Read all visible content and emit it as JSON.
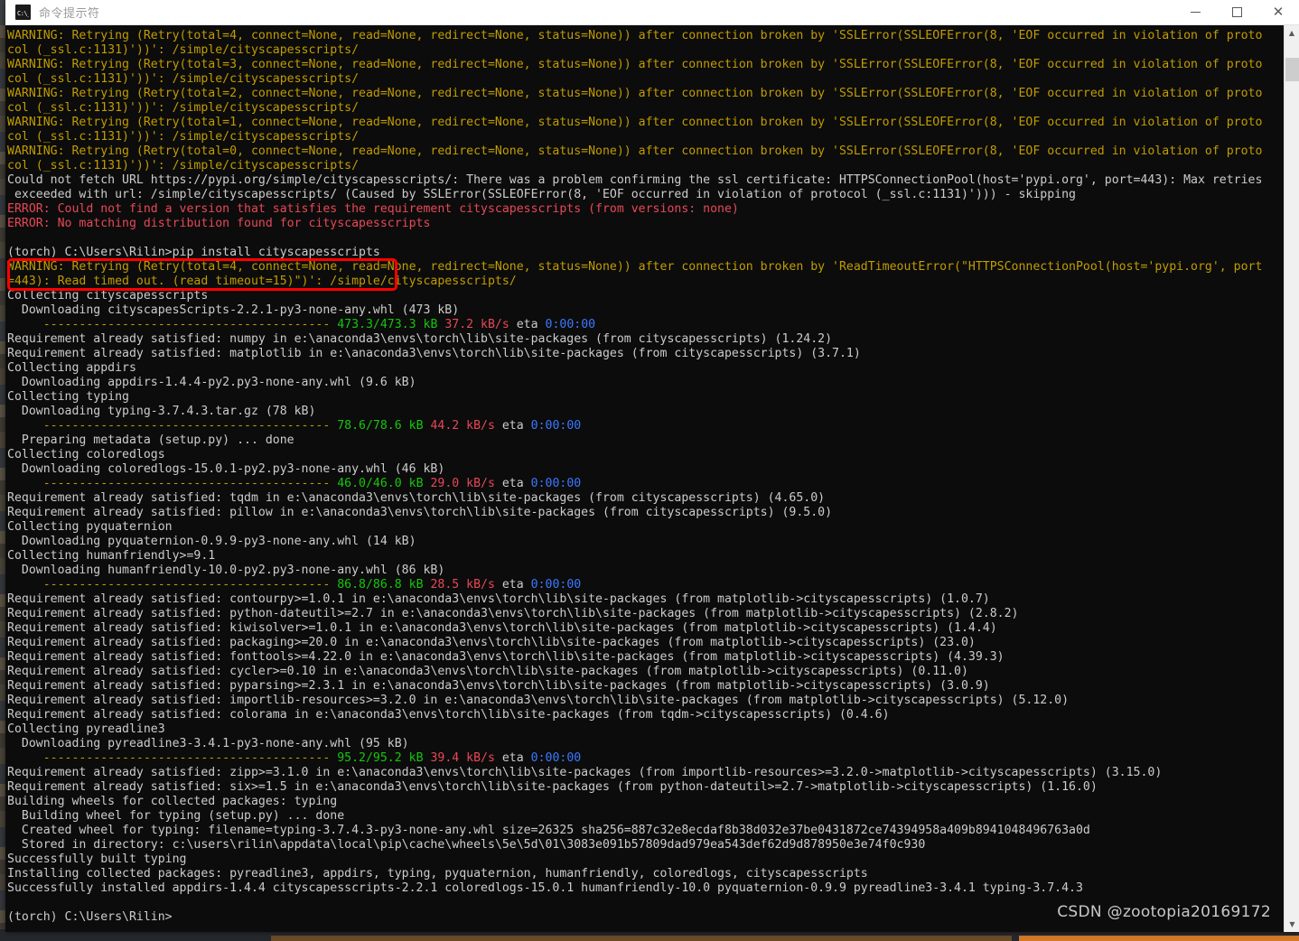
{
  "window": {
    "title": "命令提示符",
    "icon": "cmd-prompt-icon",
    "controls": {
      "minimize": "—",
      "maximize": "□",
      "close": "✕"
    }
  },
  "scrollbar": {
    "up_arrow": "▲",
    "down_arrow": "▼"
  },
  "watermark": "CSDN @zootopia20169172",
  "annotation": {
    "type": "red-rectangle-highlight",
    "color": "#ff0000",
    "target_text": "(torch) C:\\Users\\Rilin>pip install cityscapesscripts"
  },
  "palette": {
    "background": "#0c0c0c",
    "default_text": "#cccccc",
    "warning_yellow": "#c19c00",
    "error_red": "#e74856",
    "size_green": "#16c60c",
    "speed_red": "#e74856",
    "eta_blue": "#3b78ff",
    "progress_bar_yellow": "#c19c00"
  },
  "console": {
    "lines": [
      [
        {
          "t": "WARNING: Retrying (Retry(total=4, connect=None, read=None, redirect=None, status=None)) after connection broken by 'SSLError(SSLEOFError(8, 'EOF occurred in violation of proto",
          "c": "c-yellow"
        }
      ],
      [
        {
          "t": "col (_ssl.c:1131)'))': /simple/cityscapesscripts/",
          "c": "c-yellow"
        }
      ],
      [
        {
          "t": "WARNING: Retrying (Retry(total=3, connect=None, read=None, redirect=None, status=None)) after connection broken by 'SSLError(SSLEOFError(8, 'EOF occurred in violation of proto",
          "c": "c-yellow"
        }
      ],
      [
        {
          "t": "col (_ssl.c:1131)'))': /simple/cityscapesscripts/",
          "c": "c-yellow"
        }
      ],
      [
        {
          "t": "WARNING: Retrying (Retry(total=2, connect=None, read=None, redirect=None, status=None)) after connection broken by 'SSLError(SSLEOFError(8, 'EOF occurred in violation of proto",
          "c": "c-yellow"
        }
      ],
      [
        {
          "t": "col (_ssl.c:1131)'))': /simple/cityscapesscripts/",
          "c": "c-yellow"
        }
      ],
      [
        {
          "t": "WARNING: Retrying (Retry(total=1, connect=None, read=None, redirect=None, status=None)) after connection broken by 'SSLError(SSLEOFError(8, 'EOF occurred in violation of proto",
          "c": "c-yellow"
        }
      ],
      [
        {
          "t": "col (_ssl.c:1131)'))': /simple/cityscapesscripts/",
          "c": "c-yellow"
        }
      ],
      [
        {
          "t": "WARNING: Retrying (Retry(total=0, connect=None, read=None, redirect=None, status=None)) after connection broken by 'SSLError(SSLEOFError(8, 'EOF occurred in violation of proto",
          "c": "c-yellow"
        }
      ],
      [
        {
          "t": "col (_ssl.c:1131)'))': /simple/cityscapesscripts/",
          "c": "c-yellow"
        }
      ],
      [
        {
          "t": "Could not fetch URL https://pypi.org/simple/cityscapesscripts/: There was a problem confirming the ssl certificate: HTTPSConnectionPool(host='pypi.org', port=443): Max retries",
          "c": "c-white"
        }
      ],
      [
        {
          "t": " exceeded with url: /simple/cityscapesscripts/ (Caused by SSLError(SSLEOFError(8, 'EOF occurred in violation of protocol (_ssl.c:1131)'))) - skipping",
          "c": "c-white"
        }
      ],
      [
        {
          "t": "ERROR: Could not find a version that satisfies the requirement cityscapesscripts (from versions: none)",
          "c": "c-red"
        }
      ],
      [
        {
          "t": "ERROR: No matching distribution found for cityscapesscripts",
          "c": "c-red"
        }
      ],
      [
        {
          "t": "",
          "c": "c-white"
        }
      ],
      [
        {
          "t": "(torch) C:\\Users\\Rilin>pip install cityscapesscripts",
          "c": "c-white"
        }
      ],
      [
        {
          "t": "WARNING: Retrying (Retry(total=4, connect=None, read=None, redirect=None, status=None)) after connection broken by 'ReadTimeoutError(\"HTTPSConnectionPool(host='pypi.org', port",
          "c": "c-yellow"
        }
      ],
      [
        {
          "t": "=443): Read timed out. (read timeout=15)\")': /simple/cityscapesscripts/",
          "c": "c-yellow"
        }
      ],
      [
        {
          "t": "Collecting cityscapesscripts",
          "c": "c-white"
        }
      ],
      [
        {
          "t": "  Downloading cityscapesScripts-2.2.1-py3-none-any.whl (473 kB)",
          "c": "c-white"
        }
      ],
      [
        {
          "t": "     ",
          "c": "c-white"
        },
        {
          "t": "---------------------------------------- ",
          "c": "c-yellow"
        },
        {
          "t": "473.3/473.3 kB ",
          "c": "c-green"
        },
        {
          "t": "37.2 kB/s ",
          "c": "c-red"
        },
        {
          "t": "eta ",
          "c": "c-white"
        },
        {
          "t": "0:00:00",
          "c": "c-cyan"
        }
      ],
      [
        {
          "t": "Requirement already satisfied: numpy in e:\\anaconda3\\envs\\torch\\lib\\site-packages (from cityscapesscripts) (1.24.2)",
          "c": "c-white"
        }
      ],
      [
        {
          "t": "Requirement already satisfied: matplotlib in e:\\anaconda3\\envs\\torch\\lib\\site-packages (from cityscapesscripts) (3.7.1)",
          "c": "c-white"
        }
      ],
      [
        {
          "t": "Collecting appdirs",
          "c": "c-white"
        }
      ],
      [
        {
          "t": "  Downloading appdirs-1.4.4-py2.py3-none-any.whl (9.6 kB)",
          "c": "c-white"
        }
      ],
      [
        {
          "t": "Collecting typing",
          "c": "c-white"
        }
      ],
      [
        {
          "t": "  Downloading typing-3.7.4.3.tar.gz (78 kB)",
          "c": "c-white"
        }
      ],
      [
        {
          "t": "     ",
          "c": "c-white"
        },
        {
          "t": "---------------------------------------- ",
          "c": "c-yellow"
        },
        {
          "t": "78.6/78.6 kB ",
          "c": "c-green"
        },
        {
          "t": "44.2 kB/s ",
          "c": "c-red"
        },
        {
          "t": "eta ",
          "c": "c-white"
        },
        {
          "t": "0:00:00",
          "c": "c-cyan"
        }
      ],
      [
        {
          "t": "  Preparing metadata (setup.py) ... done",
          "c": "c-white"
        }
      ],
      [
        {
          "t": "Collecting coloredlogs",
          "c": "c-white"
        }
      ],
      [
        {
          "t": "  Downloading coloredlogs-15.0.1-py2.py3-none-any.whl (46 kB)",
          "c": "c-white"
        }
      ],
      [
        {
          "t": "     ",
          "c": "c-white"
        },
        {
          "t": "---------------------------------------- ",
          "c": "c-yellow"
        },
        {
          "t": "46.0/46.0 kB ",
          "c": "c-green"
        },
        {
          "t": "29.0 kB/s ",
          "c": "c-red"
        },
        {
          "t": "eta ",
          "c": "c-white"
        },
        {
          "t": "0:00:00",
          "c": "c-cyan"
        }
      ],
      [
        {
          "t": "Requirement already satisfied: tqdm in e:\\anaconda3\\envs\\torch\\lib\\site-packages (from cityscapesscripts) (4.65.0)",
          "c": "c-white"
        }
      ],
      [
        {
          "t": "Requirement already satisfied: pillow in e:\\anaconda3\\envs\\torch\\lib\\site-packages (from cityscapesscripts) (9.5.0)",
          "c": "c-white"
        }
      ],
      [
        {
          "t": "Collecting pyquaternion",
          "c": "c-white"
        }
      ],
      [
        {
          "t": "  Downloading pyquaternion-0.9.9-py3-none-any.whl (14 kB)",
          "c": "c-white"
        }
      ],
      [
        {
          "t": "Collecting humanfriendly>=9.1",
          "c": "c-white"
        }
      ],
      [
        {
          "t": "  Downloading humanfriendly-10.0-py2.py3-none-any.whl (86 kB)",
          "c": "c-white"
        }
      ],
      [
        {
          "t": "     ",
          "c": "c-white"
        },
        {
          "t": "---------------------------------------- ",
          "c": "c-yellow"
        },
        {
          "t": "86.8/86.8 kB ",
          "c": "c-green"
        },
        {
          "t": "28.5 kB/s ",
          "c": "c-red"
        },
        {
          "t": "eta ",
          "c": "c-white"
        },
        {
          "t": "0:00:00",
          "c": "c-cyan"
        }
      ],
      [
        {
          "t": "Requirement already satisfied: contourpy>=1.0.1 in e:\\anaconda3\\envs\\torch\\lib\\site-packages (from matplotlib->cityscapesscripts) (1.0.7)",
          "c": "c-white"
        }
      ],
      [
        {
          "t": "Requirement already satisfied: python-dateutil>=2.7 in e:\\anaconda3\\envs\\torch\\lib\\site-packages (from matplotlib->cityscapesscripts) (2.8.2)",
          "c": "c-white"
        }
      ],
      [
        {
          "t": "Requirement already satisfied: kiwisolver>=1.0.1 in e:\\anaconda3\\envs\\torch\\lib\\site-packages (from matplotlib->cityscapesscripts) (1.4.4)",
          "c": "c-white"
        }
      ],
      [
        {
          "t": "Requirement already satisfied: packaging>=20.0 in e:\\anaconda3\\envs\\torch\\lib\\site-packages (from matplotlib->cityscapesscripts) (23.0)",
          "c": "c-white"
        }
      ],
      [
        {
          "t": "Requirement already satisfied: fonttools>=4.22.0 in e:\\anaconda3\\envs\\torch\\lib\\site-packages (from matplotlib->cityscapesscripts) (4.39.3)",
          "c": "c-white"
        }
      ],
      [
        {
          "t": "Requirement already satisfied: cycler>=0.10 in e:\\anaconda3\\envs\\torch\\lib\\site-packages (from matplotlib->cityscapesscripts) (0.11.0)",
          "c": "c-white"
        }
      ],
      [
        {
          "t": "Requirement already satisfied: pyparsing>=2.3.1 in e:\\anaconda3\\envs\\torch\\lib\\site-packages (from matplotlib->cityscapesscripts) (3.0.9)",
          "c": "c-white"
        }
      ],
      [
        {
          "t": "Requirement already satisfied: importlib-resources>=3.2.0 in e:\\anaconda3\\envs\\torch\\lib\\site-packages (from matplotlib->cityscapesscripts) (5.12.0)",
          "c": "c-white"
        }
      ],
      [
        {
          "t": "Requirement already satisfied: colorama in e:\\anaconda3\\envs\\torch\\lib\\site-packages (from tqdm->cityscapesscripts) (0.4.6)",
          "c": "c-white"
        }
      ],
      [
        {
          "t": "Collecting pyreadline3",
          "c": "c-white"
        }
      ],
      [
        {
          "t": "  Downloading pyreadline3-3.4.1-py3-none-any.whl (95 kB)",
          "c": "c-white"
        }
      ],
      [
        {
          "t": "     ",
          "c": "c-white"
        },
        {
          "t": "---------------------------------------- ",
          "c": "c-yellow"
        },
        {
          "t": "95.2/95.2 kB ",
          "c": "c-green"
        },
        {
          "t": "39.4 kB/s ",
          "c": "c-red"
        },
        {
          "t": "eta ",
          "c": "c-white"
        },
        {
          "t": "0:00:00",
          "c": "c-cyan"
        }
      ],
      [
        {
          "t": "Requirement already satisfied: zipp>=3.1.0 in e:\\anaconda3\\envs\\torch\\lib\\site-packages (from importlib-resources>=3.2.0->matplotlib->cityscapesscripts) (3.15.0)",
          "c": "c-white"
        }
      ],
      [
        {
          "t": "Requirement already satisfied: six>=1.5 in e:\\anaconda3\\envs\\torch\\lib\\site-packages (from python-dateutil>=2.7->matplotlib->cityscapesscripts) (1.16.0)",
          "c": "c-white"
        }
      ],
      [
        {
          "t": "Building wheels for collected packages: typing",
          "c": "c-white"
        }
      ],
      [
        {
          "t": "  Building wheel for typing (setup.py) ... done",
          "c": "c-white"
        }
      ],
      [
        {
          "t": "  Created wheel for typing: filename=typing-3.7.4.3-py3-none-any.whl size=26325 sha256=887c32e8ecdaf8b38d032e37be0431872ce74394958a409b8941048496763a0d",
          "c": "c-white"
        }
      ],
      [
        {
          "t": "  Stored in directory: c:\\users\\rilin\\appdata\\local\\pip\\cache\\wheels\\5e\\5d\\01\\3083e091b57809dad979ea543def62d9d878950e3e74f0c930",
          "c": "c-white"
        }
      ],
      [
        {
          "t": "Successfully built typing",
          "c": "c-white"
        }
      ],
      [
        {
          "t": "Installing collected packages: pyreadline3, appdirs, typing, pyquaternion, humanfriendly, coloredlogs, cityscapesscripts",
          "c": "c-white"
        }
      ],
      [
        {
          "t": "Successfully installed appdirs-1.4.4 cityscapesscripts-2.2.1 coloredlogs-15.0.1 humanfriendly-10.0 pyquaternion-0.9.9 pyreadline3-3.4.1 typing-3.7.4.3",
          "c": "c-white"
        }
      ],
      [
        {
          "t": "",
          "c": "c-white"
        }
      ],
      [
        {
          "t": "(torch) C:\\Users\\Rilin>",
          "c": "c-white"
        }
      ]
    ]
  }
}
